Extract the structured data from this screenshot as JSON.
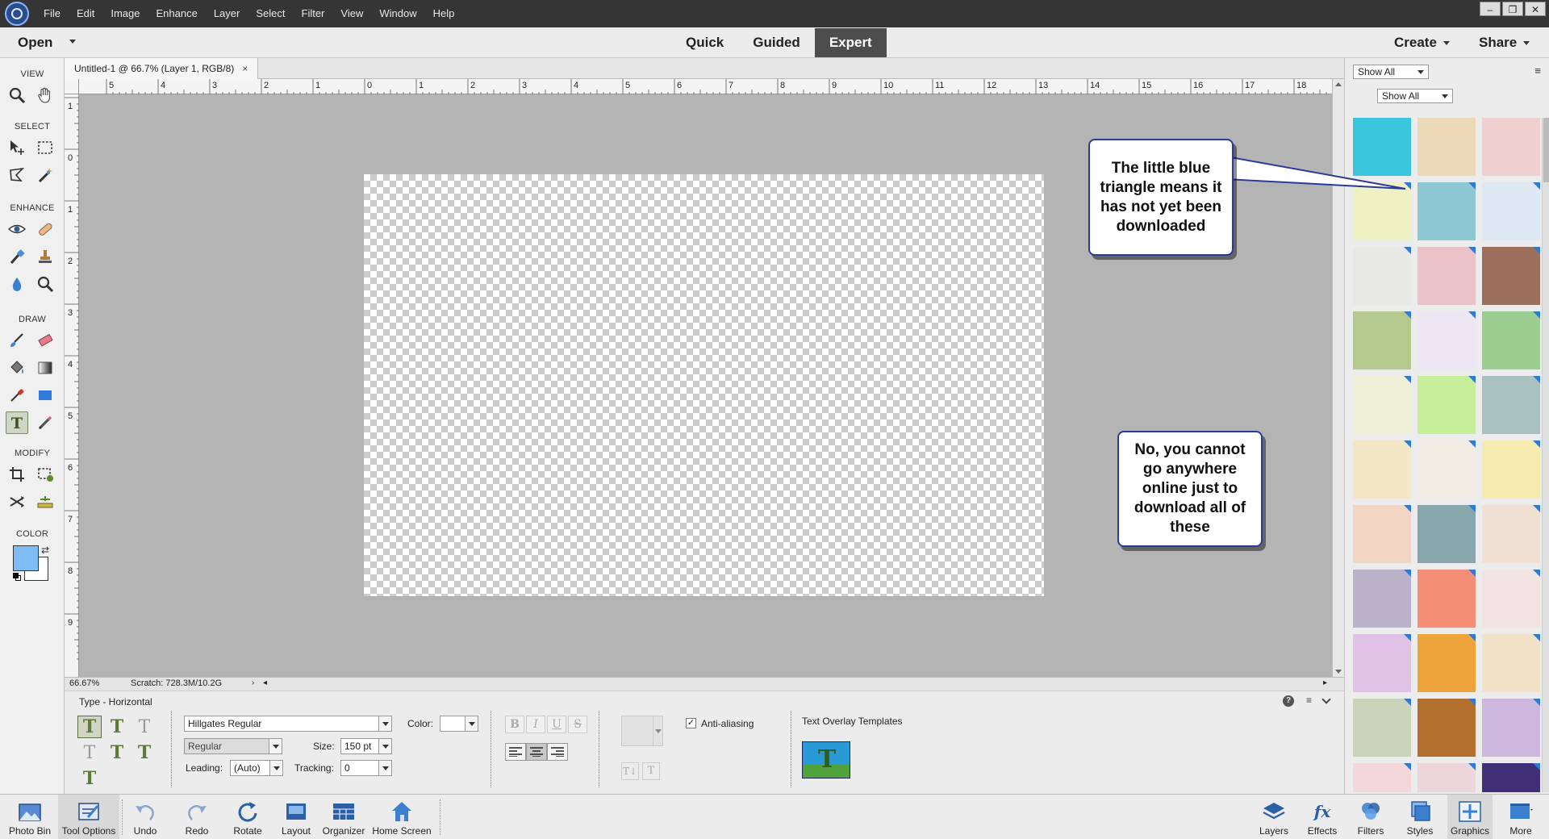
{
  "menubar": {
    "items": [
      "File",
      "Edit",
      "Image",
      "Enhance",
      "Layer",
      "Select",
      "Filter",
      "View",
      "Window",
      "Help"
    ]
  },
  "modebar": {
    "open_label": "Open",
    "tabs": [
      "Quick",
      "Guided",
      "Expert"
    ],
    "active_tab": "Expert",
    "create_label": "Create",
    "share_label": "Share"
  },
  "toolbox": {
    "sections": [
      "VIEW",
      "SELECT",
      "ENHANCE",
      "DRAW",
      "MODIFY",
      "COLOR"
    ],
    "foreground_color": "#7fbcf3",
    "background_color": "#ffffff",
    "active_tool": "type-tool"
  },
  "document": {
    "tab_label": "Untitled-1 @ 66.7% (Layer 1, RGB/8)",
    "close_glyph": "×",
    "ruler_top": [
      "5",
      "4",
      "3",
      "2",
      "1",
      "0",
      "1",
      "2",
      "3",
      "4",
      "5",
      "6",
      "7",
      "8",
      "9",
      "10",
      "11",
      "12",
      "13",
      "14",
      "15",
      "16",
      "17",
      "18"
    ],
    "ruler_left": [
      "1",
      "0",
      "1",
      "2",
      "3",
      "4",
      "5",
      "6",
      "7",
      "8",
      "9"
    ]
  },
  "statusbar": {
    "zoom": "66.67%",
    "scratch": "Scratch: 728.3M/10.2G"
  },
  "tooloptions": {
    "title": "Type - Horizontal",
    "font_family": "Hillgates Regular",
    "font_style": "Regular",
    "size_label": "Size:",
    "size_value": "150 pt",
    "leading_label": "Leading:",
    "leading_value": "(Auto)",
    "tracking_label": "Tracking:",
    "tracking_value": "0",
    "color_label": "Color:",
    "bold_glyph": "B",
    "italic_glyph": "I",
    "underline_glyph": "U",
    "strike_glyph": "S",
    "anti_aliasing_label": "Anti-aliasing",
    "anti_aliasing_checked": true,
    "templates_label": "Text Overlay Templates"
  },
  "rightpanel": {
    "filter_1": "Show All",
    "filter_2": "Show All",
    "thumbnails": [
      {
        "color": "#3cc6de",
        "triangle": false
      },
      {
        "color": "#ecd9b8",
        "triangle": false
      },
      {
        "color": "#f0d0d0",
        "triangle": false
      },
      {
        "color": "#eef1c4",
        "triangle": true
      },
      {
        "color": "#8ec8d2",
        "triangle": true
      },
      {
        "color": "#dfe9f3",
        "triangle": true
      },
      {
        "color": "#e8e8e6",
        "triangle": true
      },
      {
        "color": "#ebc2c8",
        "triangle": true
      },
      {
        "color": "#9b6f5c",
        "triangle": true
      },
      {
        "color": "#b6c98f",
        "triangle": true
      },
      {
        "color": "#ece7f2",
        "triangle": true
      },
      {
        "color": "#9ccd91",
        "triangle": true
      },
      {
        "color": "#eef0d8",
        "triangle": true
      },
      {
        "color": "#c7ee9a",
        "triangle": true
      },
      {
        "color": "#a9c2c0",
        "triangle": true
      },
      {
        "color": "#f3e7c6",
        "triangle": true
      },
      {
        "color": "#f1ede4",
        "triangle": true
      },
      {
        "color": "#f7ecb0",
        "triangle": true
      },
      {
        "color": "#f2d6c3",
        "triangle": true
      },
      {
        "color": "#89a8ae",
        "triangle": true
      },
      {
        "color": "#f0e0d4",
        "triangle": true
      },
      {
        "color": "#b9b2c8",
        "triangle": true
      },
      {
        "color": "#f58e76",
        "triangle": true
      },
      {
        "color": "#f1e4e2",
        "triangle": true
      },
      {
        "color": "#e0c2e6",
        "triangle": true
      },
      {
        "color": "#efa33c",
        "triangle": true
      },
      {
        "color": "#f1e1c8",
        "triangle": true
      },
      {
        "color": "#c9d4ba",
        "triangle": true
      },
      {
        "color": "#b2702e",
        "triangle": true
      },
      {
        "color": "#cdb7dd",
        "triangle": true
      },
      {
        "color": "#f3d7da",
        "triangle": true
      },
      {
        "color": "#edd5dc",
        "triangle": true
      },
      {
        "color": "#3e2f76",
        "triangle": true
      }
    ]
  },
  "callouts": {
    "triangle_note": "The little blue triangle means it has not yet been downloaded",
    "download_note": "No, you cannot go anywhere online just to download all of these"
  },
  "bottombar": {
    "left": [
      "Photo Bin",
      "Tool Options",
      "Undo",
      "Redo",
      "Rotate",
      "Layout",
      "Organizer",
      "Home Screen"
    ],
    "right": [
      "Layers",
      "Effects",
      "Filters",
      "Styles",
      "Graphics",
      "More"
    ]
  }
}
